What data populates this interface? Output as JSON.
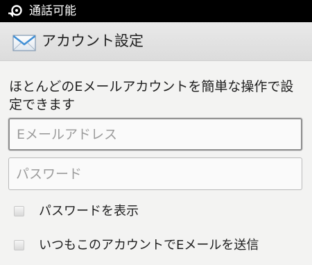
{
  "status_bar": {
    "text": "通話可能",
    "icon": "phone-sync-icon",
    "background": "#000000"
  },
  "header": {
    "title": "アカウント設定",
    "icon": "mail-envelope-icon"
  },
  "main": {
    "instructions": "ほとんどのEメールアカウントを簡単な操作で設定できます",
    "email_field": {
      "value": "",
      "placeholder": "Eメールアドレス"
    },
    "password_field": {
      "value": "",
      "placeholder": "パスワード"
    },
    "show_password": {
      "label": "パスワードを表示",
      "checked": false
    },
    "default_account": {
      "label": "いつもこのアカウントでEメールを送信",
      "checked": false
    }
  }
}
